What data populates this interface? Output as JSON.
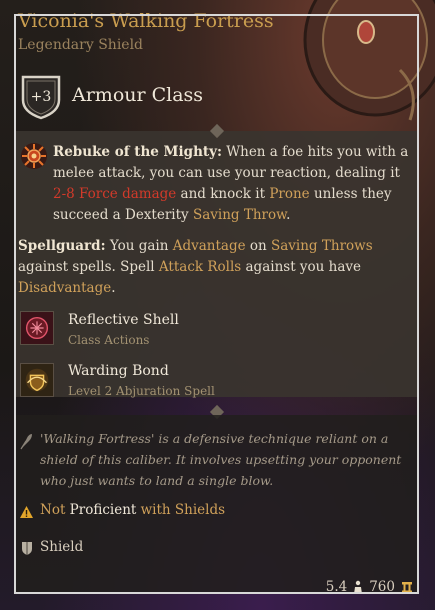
{
  "item": {
    "name": "Viconia's Walking Fortress",
    "rarity": "Legendary Shield",
    "rarity_color": "#c99d4f"
  },
  "armour": {
    "value": "+3",
    "label": "Armour Class",
    "icon": "shield-badge-icon"
  },
  "rebuke": {
    "icon": "rebuke-sun-icon",
    "name": "Rebuke of the Mighty:",
    "t1": " When a foe hits you with a melee attack, you can use your reaction, dealing it ",
    "damage": "2-8 Force damage",
    "t2": " and knock it ",
    "prone": "Prone",
    "t3": " unless they succeed a Dexterity ",
    "saving_throw": "Saving Throw",
    "t4": "."
  },
  "spellguard": {
    "name": "Spellguard:",
    "t1": " You gain ",
    "advantage": "Advantage",
    "t2": " on ",
    "saving_throws": "Saving Throws",
    "t3": " against spells. Spell ",
    "attack_rolls": "Attack Rolls",
    "t4": " against you have ",
    "disadvantage": "Disadvantage",
    "t5": "."
  },
  "actions": [
    {
      "title": "Reflective Shell",
      "subtitle": "Class Actions",
      "icon": "reflective-shell-icon"
    },
    {
      "title": "Warding Bond",
      "subtitle": "Level 2 Abjuration Spell",
      "icon": "warding-bond-icon"
    }
  ],
  "lore": "'Walking Fortress' is a defensive technique reliant on a shield of this caliber. It involves upsetting your opponent who just wants to land a single blow.",
  "proficiency": {
    "icon": "warning-icon",
    "not": "Not",
    "proficient": " Proficient",
    "with_shields": " with Shields"
  },
  "item_type": {
    "icon": "shield-icon",
    "label": "Shield"
  },
  "footer": {
    "weight": "5.4",
    "weight_icon": "weight-icon",
    "value": "760",
    "value_icon": "gold-icon"
  },
  "colors": {
    "gold": "#d0a15a",
    "damage_red": "#d23a2a",
    "frame": "#d8d8d8"
  }
}
